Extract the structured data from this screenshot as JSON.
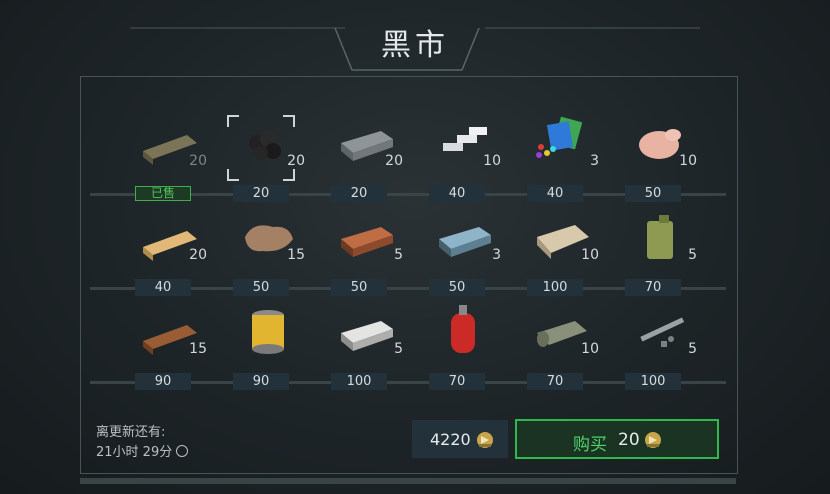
{
  "title": "黑市",
  "slots": [
    {
      "name": "wooden-plank",
      "qty": "20",
      "price": "已售",
      "sold": true
    },
    {
      "name": "coal",
      "qty": "20",
      "price": "20",
      "selected": true
    },
    {
      "name": "iron-ingot",
      "qty": "20",
      "price": "20"
    },
    {
      "name": "aluminum-bars",
      "qty": "10",
      "price": "40"
    },
    {
      "name": "gems",
      "qty": "3",
      "price": "40"
    },
    {
      "name": "raw-chicken",
      "qty": "10",
      "price": "50"
    },
    {
      "name": "pine-plank",
      "qty": "20",
      "price": "40"
    },
    {
      "name": "leather",
      "qty": "15",
      "price": "50"
    },
    {
      "name": "copper-ingot",
      "qty": "5",
      "price": "50"
    },
    {
      "name": "steel-ingot",
      "qty": "3",
      "price": "50"
    },
    {
      "name": "cloth",
      "qty": "10",
      "price": "100"
    },
    {
      "name": "fuel-canister",
      "qty": "5",
      "price": "70"
    },
    {
      "name": "oak-plank",
      "qty": "15",
      "price": "90"
    },
    {
      "name": "oil-filter",
      "qty": "",
      "price": "90"
    },
    {
      "name": "silver-ingot",
      "qty": "5",
      "price": "100"
    },
    {
      "name": "gas-cylinder",
      "qty": "",
      "price": "70"
    },
    {
      "name": "fabric-roll",
      "qty": "10",
      "price": "70"
    },
    {
      "name": "metal-parts",
      "qty": "5",
      "price": "100"
    }
  ],
  "footer": {
    "refresh_label": "离更新还有:",
    "refresh_time": "21小时 29分",
    "balance": "4220",
    "buy_label": "购买",
    "buy_cost": "20"
  },
  "colors": {
    "accent": "#2fb94a",
    "price_bg": "#23323a",
    "coin": "#c9a54a"
  }
}
